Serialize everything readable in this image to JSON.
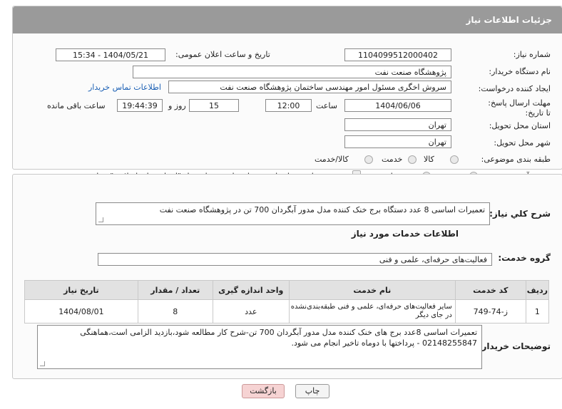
{
  "header": {
    "title": "جزئیات اطلاعات نیاز"
  },
  "fields": {
    "need_number_label": "شماره نیاز:",
    "need_number": "1104099512000402",
    "announce_label": "تاریخ و ساعت اعلان عمومی:",
    "announce_value": "1404/05/21 - 15:34",
    "buyer_label": "نام دستگاه خریدار:",
    "buyer_value": "پژوهشگاه صنعت نفت",
    "creator_label": "ایجاد کننده درخواست:",
    "creator_value": "سروش اخگری مسئول امور مهندسی ساختمان پژوهشگاه صنعت نفت",
    "contact_link": "اطلاعات تماس خریدار",
    "deadline_label": "مهلت ارسال پاسخ: تا تاریخ:",
    "deadline_date": "1404/06/06",
    "time_label": "ساعت",
    "deadline_time": "12:00",
    "days_value": "15",
    "days_label": "روز و",
    "remaining_time": "19:44:39",
    "remaining_label": "ساعت باقی مانده",
    "province_label": "استان محل تحویل:",
    "province_value": "تهران",
    "city_label": "شهر محل تحویل:",
    "city_value": "تهران",
    "category_label": "طبقه بندی موضوعی:",
    "category_options": [
      "کالا",
      "خدمت",
      "کالا/خدمت"
    ],
    "process_label": "نوع فرآیند خرید :",
    "process_options": [
      "جزیی",
      "متوسط"
    ],
    "payment_note": "پرداخت تمام یا بخشی از مبلغ خرید،از محل \"اسناد خزانه اسلامی\" خواهد بود."
  },
  "summary": {
    "label": "شرح کلي نياز:",
    "value": "تعمیرات اساسی 8 عدد دستگاه برج خنک کننده مدل مدور آبگردان 700 تن در پژوهشگاه صنعت نفت"
  },
  "services_title": "اطلاعات خدمات مورد نیاز",
  "service_group": {
    "label": "گروه خدمت:",
    "value": "فعالیت‌های حرفه‌ای، علمی و فنی"
  },
  "table": {
    "headers": [
      "ردیف",
      "کد خدمت",
      "نام خدمت",
      "واحد اندازه گیری",
      "تعداد / مقدار",
      "تاریخ نیاز"
    ],
    "rows": [
      [
        "1",
        "ز-74-749",
        "سایر فعالیت‌های حرفه‌ای، علمی و فنی طبقه‌بندی‌نشده در جای دیگر",
        "عدد",
        "8",
        "1404/08/01"
      ]
    ]
  },
  "buyer_notes": {
    "label": "توضیحات خریدار:",
    "value": "تعمیرات اساسی 8عدد برج های خنک کننده مدل مدور آبگردان 700 تن-شرح کار مطالعه شود،بازدید الزامی است،هماهنگی 02148255847 - پرداختها با دوماه تاخیر انجام می شود."
  },
  "buttons": {
    "print": "چاپ",
    "back": "بازگشت"
  },
  "colors": {
    "header_bg": "#9a9a9a",
    "link": "#1a5fb4",
    "back_btn": "#f6d3d3"
  }
}
